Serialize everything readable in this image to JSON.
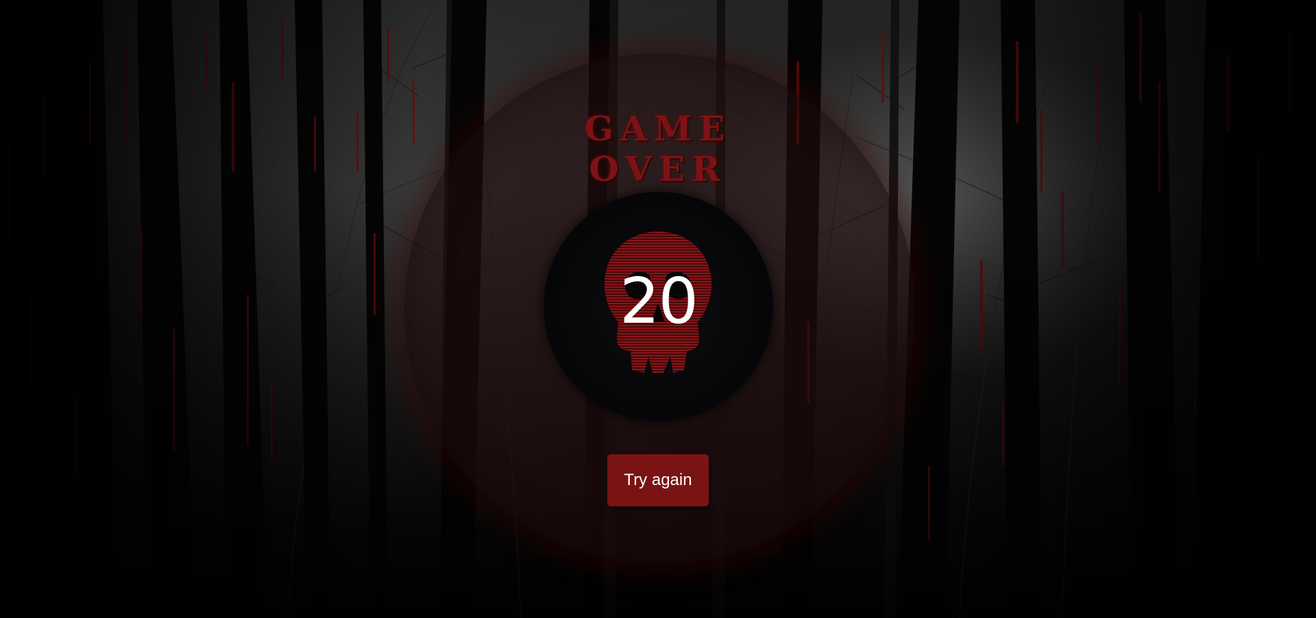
{
  "game_over": {
    "title": "GAME OVER",
    "score": "20",
    "try_again_label": "Try again"
  },
  "theme": {
    "accent": "#7a1414",
    "title_color": "#7d1216",
    "blood_drip": "#6e0e0e"
  },
  "icons": {
    "skull": "skull-icon",
    "background": "dark-forest-background"
  }
}
